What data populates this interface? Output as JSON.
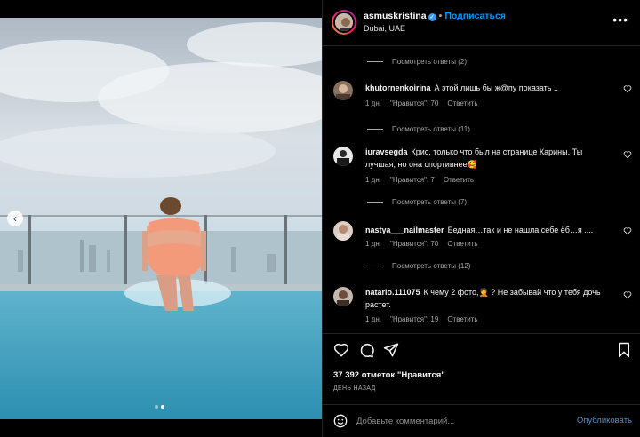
{
  "post": {
    "username": "asmuskristina",
    "separator": "•",
    "follow_label": "Подписаться",
    "location": "Dubai, UAE",
    "more_label": "•••"
  },
  "carousel": {
    "total": 2,
    "current": 2
  },
  "comments": [
    {
      "replies_label": "Посмотреть ответы (2)"
    },
    {
      "username": "khutornenkoirina",
      "text": "А этой лишь бы ж@пу показать ..",
      "time": "1 дн.",
      "likes_label": "\"Нравится\": 70",
      "reply_label": "Ответить",
      "replies_label": "Посмотреть ответы (11)"
    },
    {
      "username": "iuravsegda",
      "text": "Крис, только что был на странице Карины. Ты лучшая, но она спортивнее🥰",
      "time": "1 дн.",
      "likes_label": "\"Нравится\": 7",
      "reply_label": "Ответить",
      "replies_label": "Посмотреть ответы (7)"
    },
    {
      "username": "nastya___nailmaster",
      "text": "Бедная…так и не нашла себе ёб…я ....",
      "time": "1 дн.",
      "likes_label": "\"Нравится\": 70",
      "reply_label": "Ответить",
      "replies_label": "Посмотреть ответы (12)"
    },
    {
      "username": "natario.111075",
      "text": "К чему 2 фото,🤦 ? Не забывай что у тебя дочь растет.",
      "time": "1 дн.",
      "likes_label": "\"Нравится\": 19",
      "reply_label": "Ответить"
    }
  ],
  "actions": {
    "likes_text": "37 392 отметок \"Нравится\"",
    "date_text": "ДЕНЬ НАЗАД"
  },
  "composer": {
    "placeholder": "Добавьте комментарий...",
    "publish_label": "Опубликовать"
  },
  "colors": {
    "accent": "#0095f6",
    "background": "#000000",
    "muted": "#a8a8a8"
  },
  "icons": [
    "chevron-left-icon",
    "more-icon",
    "heart-icon",
    "comment-icon",
    "share-icon",
    "bookmark-icon",
    "emoji-icon",
    "verified-icon"
  ]
}
